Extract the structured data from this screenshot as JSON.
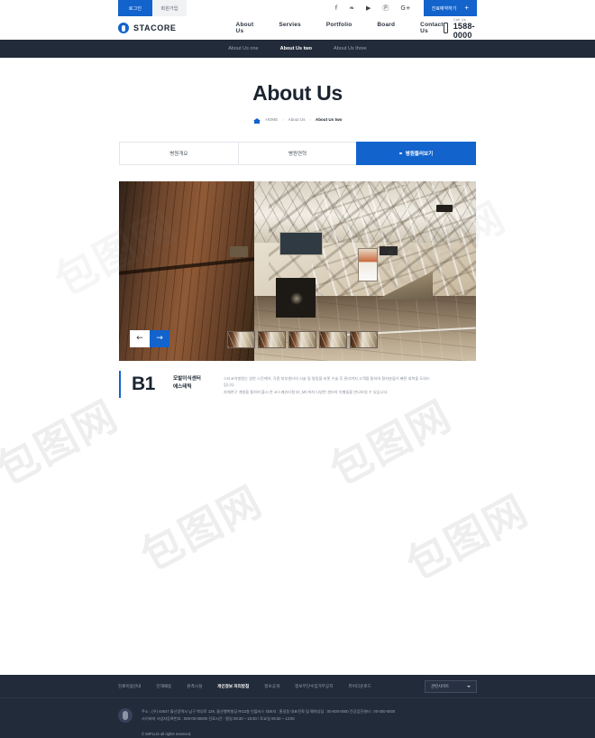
{
  "topbar": {
    "login_label": "로그인",
    "signup_label": "회원가입",
    "social": [
      {
        "name": "facebook-icon",
        "glyph": "f"
      },
      {
        "name": "twitter-icon",
        "glyph": "❧"
      },
      {
        "name": "youtube-icon",
        "glyph": "▶"
      },
      {
        "name": "pinterest-icon",
        "glyph": "Ⓟ"
      },
      {
        "name": "google-plus-icon",
        "glyph": "G+"
      }
    ],
    "cta_label": "진료예약하기",
    "cta_plus": "+"
  },
  "header": {
    "logo_text": "STACORE",
    "nav": [
      "About Us",
      "Servies",
      "Portfolio",
      "Board",
      "Contact Us"
    ],
    "call_label": "Call Us",
    "call_number": "1588-0000"
  },
  "subnav": {
    "items": [
      {
        "label": "About Us one",
        "active": false
      },
      {
        "label": "About Us two",
        "active": true
      },
      {
        "label": "About Us three",
        "active": false
      }
    ]
  },
  "page": {
    "title": "About Us",
    "breadcrumb": [
      "HOME",
      "About Us",
      "About Us two"
    ],
    "separator": "›"
  },
  "tabs": [
    {
      "label": "병원개요",
      "active": false
    },
    {
      "label": "병원연혁",
      "active": false
    },
    {
      "label": "병원둘러보기",
      "active": true
    }
  ],
  "slider": {
    "prev_glyph": "←",
    "next_glyph": "→",
    "thumb_count": 5
  },
  "caption": {
    "code": "B1",
    "name_line1": "모발이식센터",
    "name_line2": "에스테틱",
    "desc_line1": "스타코어병원는 일반 스킨케어, 각종 피부센터의 시술 및 필링을 비롯 수술 후 관리까지 고객을 통하여 환자분들이 빠른 회복을 도와드립니다.",
    "desc_line2": "자체연구 개발을 통하여 출시 한 코스메슈티컬 Dr_MC까지 다양한 센터의 차별들을 만나보실 수 있습니다."
  },
  "footer": {
    "links": [
      {
        "label": "진료이용안내",
        "bold": false
      },
      {
        "label": "인재채용",
        "bold": false
      },
      {
        "label": "원격시설",
        "bold": false
      },
      {
        "label": "개인정보 처리방침",
        "bold": true
      },
      {
        "label": "정보공개",
        "bold": false
      },
      {
        "label": "정보무단수집거부공지",
        "bold": false
      },
      {
        "label": "뷰어다운로드",
        "bold": false
      }
    ],
    "select_label": "관련사이트",
    "address_line1": "주소 : (우) 44647 울산광역시 남구 북부로 129, 울산행복빌딩 RG2층 인플러스      대표자 : 홍길동      대표전화 및 예약상담 : 00-000-0000      건강검진센터 : 00-000-0000",
    "address_line2": "사이버머 사업자등록번호 : 000-00-00000      진료시간 : 평일 09:30 ~ 18:30 / 토요일 09:30 ~ 13:00",
    "copyright": "© IMPLUS all rights reserved."
  },
  "watermarks": [
    "包图网",
    "包图网",
    "包图网",
    "包图网",
    "包图网",
    "包图网"
  ]
}
